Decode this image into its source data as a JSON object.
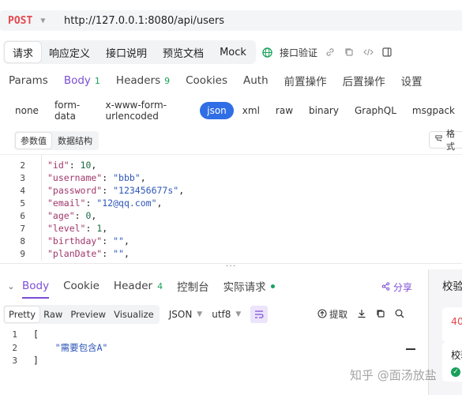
{
  "request": {
    "method": "POST",
    "url": "http://127.0.0.1:8080/api/users"
  },
  "top_tabs": [
    "请求",
    "响应定义",
    "接口说明",
    "预览文档",
    "Mock"
  ],
  "toolbar": {
    "verify_label": "接口验证"
  },
  "param_tabs": [
    {
      "label": "Params",
      "badge": ""
    },
    {
      "label": "Body",
      "badge": "1"
    },
    {
      "label": "Headers",
      "badge": "9"
    },
    {
      "label": "Cookies",
      "badge": ""
    },
    {
      "label": "Auth",
      "badge": ""
    },
    {
      "label": "前置操作",
      "badge": ""
    },
    {
      "label": "后置操作",
      "badge": ""
    },
    {
      "label": "设置",
      "badge": ""
    }
  ],
  "body_types": [
    "none",
    "form-data",
    "x-www-form-urlencoded",
    "json",
    "xml",
    "raw",
    "binary",
    "GraphQL",
    "msgpack"
  ],
  "sub_tabs": [
    "参数值",
    "数据结构"
  ],
  "format_label": "格式",
  "editor": {
    "lines": [
      {
        "no": "2",
        "key": "\"id\"",
        "val": "10",
        "type": "n"
      },
      {
        "no": "3",
        "key": "\"username\"",
        "val": "\"bbb\"",
        "type": "s"
      },
      {
        "no": "4",
        "key": "\"password\"",
        "val": "\"123456677s\"",
        "type": "s"
      },
      {
        "no": "5",
        "key": "\"email\"",
        "val": "\"12@qq.com\"",
        "type": "s"
      },
      {
        "no": "6",
        "key": "\"age\"",
        "val": "0",
        "type": "n"
      },
      {
        "no": "7",
        "key": "\"level\"",
        "val": "1",
        "type": "n"
      },
      {
        "no": "8",
        "key": "\"birthday\"",
        "val": "\"\"",
        "type": "s"
      },
      {
        "no": "9",
        "key": "\"planDate\"",
        "val": "\"\"",
        "type": "s"
      }
    ]
  },
  "response_tabs": [
    {
      "label": "Body",
      "badge": ""
    },
    {
      "label": "Cookie",
      "badge": ""
    },
    {
      "label": "Header",
      "badge": "4"
    },
    {
      "label": "控制台",
      "badge": ""
    },
    {
      "label": "实际请求",
      "badge": ""
    }
  ],
  "share_label": "分享",
  "right_panel": {
    "title": "校验",
    "status": "40",
    "verify": "校验"
  },
  "view_tabs": [
    "Pretty",
    "Raw",
    "Preview",
    "Visualize"
  ],
  "format_select": "JSON",
  "encoding_select": "utf8",
  "extract_label": "提取",
  "response_code": [
    {
      "no": "1",
      "text": "["
    },
    {
      "no": "2",
      "text": "    \"需要包含A\""
    },
    {
      "no": "3",
      "text": "]"
    }
  ],
  "watermark": "知乎 @面汤放盐"
}
